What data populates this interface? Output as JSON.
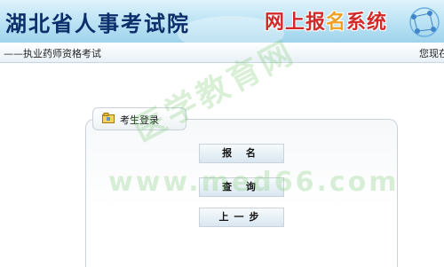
{
  "header": {
    "site_title": "湖北省人事考试院",
    "system_title_a": "网上报",
    "system_title_b": "名",
    "system_title_c": "系统"
  },
  "subbar": {
    "subtitle": "——执业药师资格考试",
    "welcome": "您现在"
  },
  "login": {
    "tab_label": "考生登录",
    "register_label": "报 名",
    "query_label": "查 询",
    "back_label": "上一步"
  },
  "watermark": {
    "text_cn": "医学教育网",
    "text_url": "www.med66.com"
  },
  "colors": {
    "header_bg": "#b9e2f4",
    "site_title": "#0c2e6a",
    "system_title": "#d12a2a"
  }
}
